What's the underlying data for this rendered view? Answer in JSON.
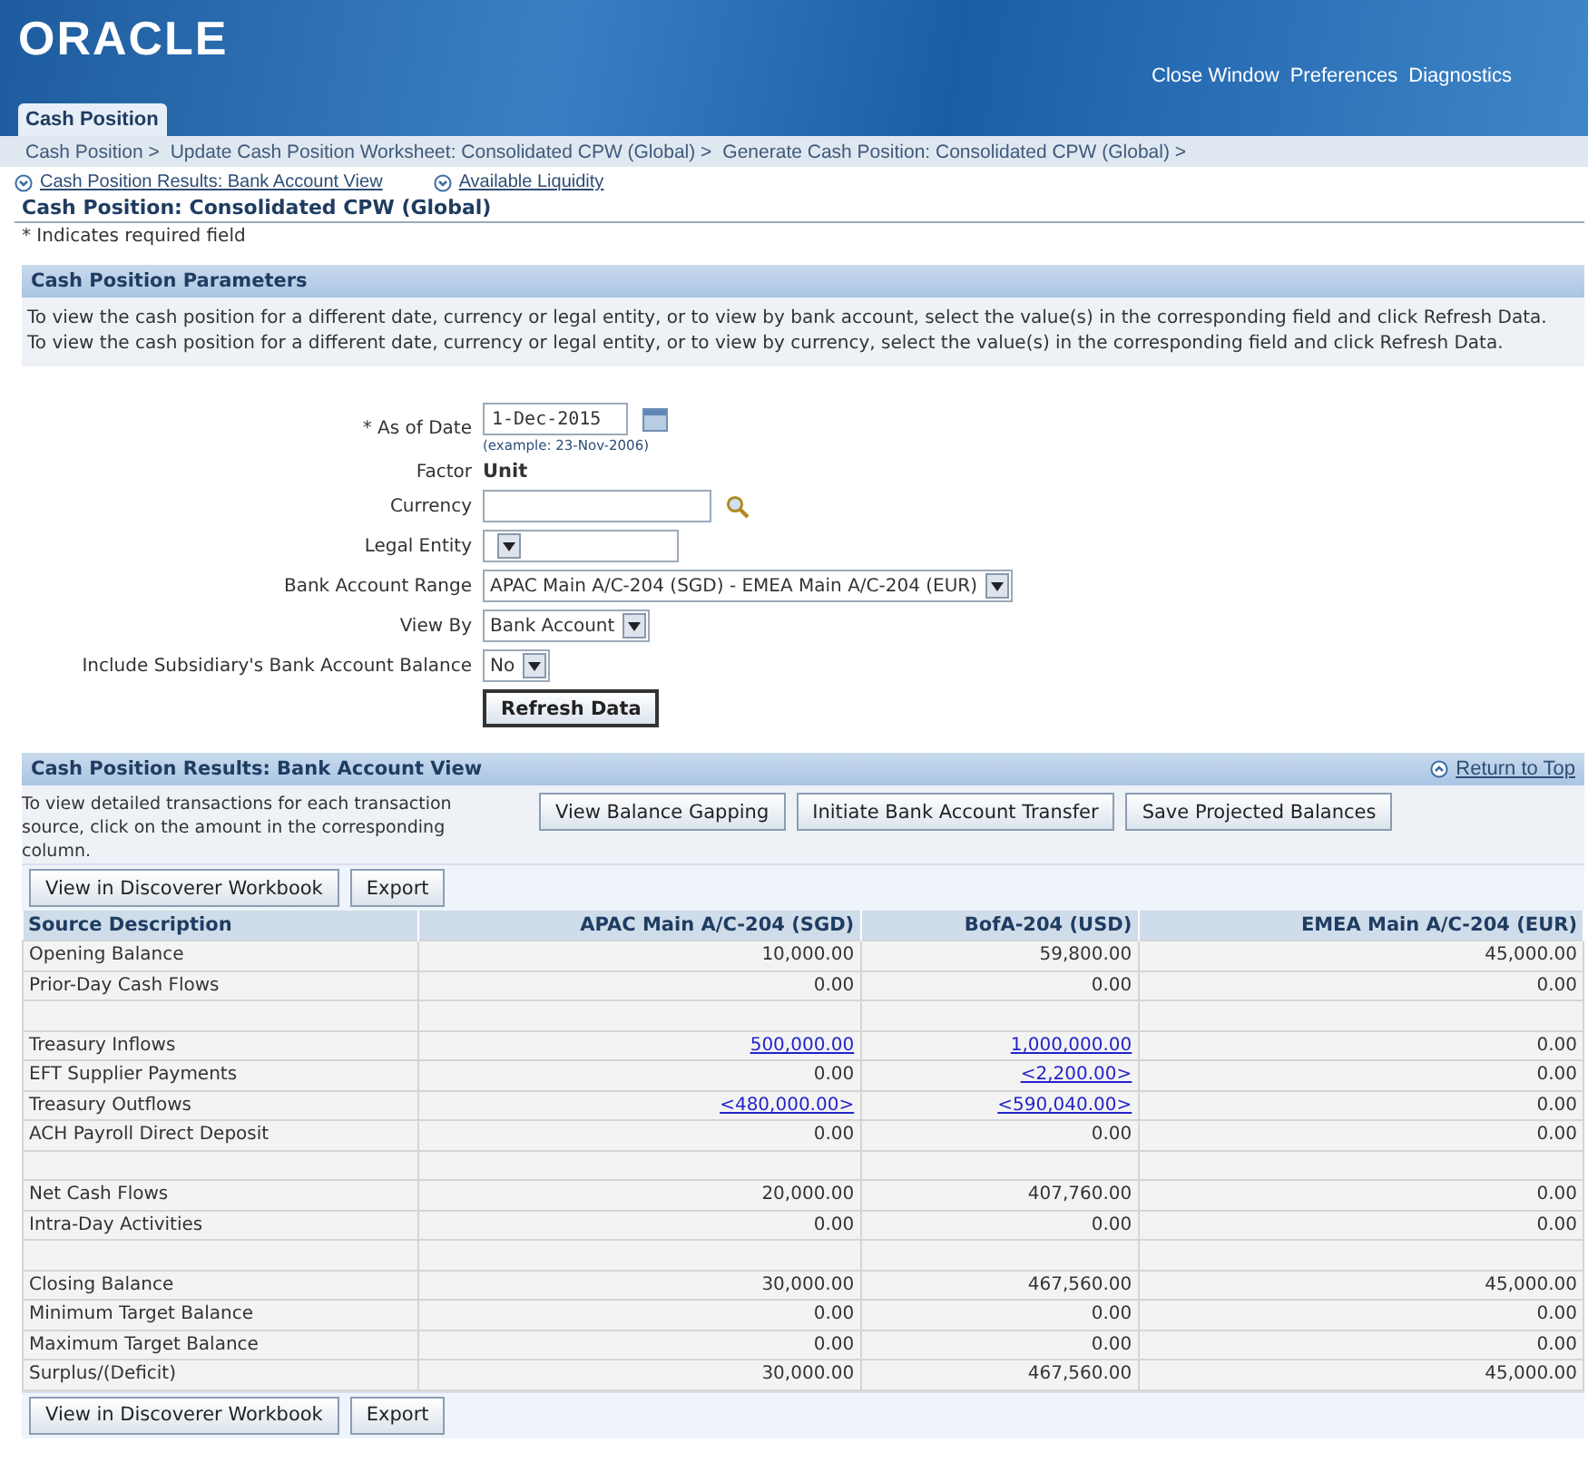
{
  "header": {
    "logo": "ORACLE",
    "links": [
      "Close Window",
      "Preferences",
      "Diagnostics"
    ],
    "tab": {
      "label": "Cash Position",
      "selected": true
    }
  },
  "breadcrumbs": [
    "Cash Position >",
    "Update Cash Position Worksheet: Consolidated CPW (Global) >",
    "Generate Cash Position: Consolidated CPW (Global) >"
  ],
  "quick_links": [
    "Cash Position Results: Bank Account View",
    "Available Liquidity"
  ],
  "page_title": "Cash Position: Consolidated CPW (Global)",
  "required_note": "* Indicates required field",
  "parameters": {
    "title": "Cash Position Parameters",
    "instructions": [
      "To view the cash position for a different date, currency or legal entity, or to view by bank account, select the value(s) in the corresponding field and click Refresh Data.",
      "To view the cash position for a different date, currency or legal entity, or to view by currency, select the value(s) in the corresponding field and click Refresh Data."
    ],
    "fields": [
      {
        "kind": "date",
        "label": "As of Date",
        "required_mark": "*",
        "value": "1-Dec-2015",
        "hint": "(example: 23-Nov-2006)"
      },
      {
        "kind": "static",
        "label": "Factor",
        "value": "Unit"
      },
      {
        "kind": "lookup",
        "label": "Currency"
      },
      {
        "kind": "select",
        "label": "Legal Entity"
      },
      {
        "kind": "select",
        "label": "Bank Account Range",
        "value": "APAC Main A/C-204 (SGD) - EMEA Main A/C-204 (EUR)"
      },
      {
        "kind": "select",
        "label": "View By",
        "value": "Bank Account"
      },
      {
        "kind": "select",
        "label": "Include Subsidiary's Bank Account Balance",
        "value": "No"
      }
    ],
    "button": "Refresh Data"
  },
  "results": {
    "title": "Cash Position Results: Bank Account View",
    "return_link": "Return to Top",
    "instructions": "To view detailed transactions for each transaction source, click on the amount in the corresponding column.",
    "actions": [
      "View Balance Gapping",
      "Initiate Bank Account Transfer",
      "Save Projected Balances"
    ],
    "table_buttons": [
      "View in Discoverer Workbook",
      "Export"
    ],
    "columns": [
      "Source Description",
      "APAC Main A/C-204 (SGD)",
      "BofA-204 (USD)",
      "EMEA Main A/C-204 (EUR)"
    ],
    "rows": [
      {
        "kind": "data",
        "label": "Opening Balance",
        "cells": [
          {
            "text": "10,000.00",
            "link": false
          },
          {
            "text": "59,800.00",
            "link": false
          },
          {
            "text": "45,000.00",
            "link": false
          }
        ]
      },
      {
        "kind": "data",
        "label": "Prior-Day Cash Flows",
        "cells": [
          {
            "text": "0.00",
            "link": false
          },
          {
            "text": "0.00",
            "link": false
          },
          {
            "text": "0.00",
            "link": false
          }
        ]
      },
      {
        "kind": "spacer"
      },
      {
        "kind": "data",
        "label": "Treasury Inflows",
        "cells": [
          {
            "text": "500,000.00",
            "link": true
          },
          {
            "text": "1,000,000.00",
            "link": true
          },
          {
            "text": "0.00",
            "link": false
          }
        ]
      },
      {
        "kind": "data",
        "label": "EFT Supplier Payments",
        "cells": [
          {
            "text": "0.00",
            "link": false
          },
          {
            "text": "<2,200.00>",
            "link": true
          },
          {
            "text": "0.00",
            "link": false
          }
        ]
      },
      {
        "kind": "data",
        "label": "Treasury Outflows",
        "cells": [
          {
            "text": "<480,000.00>",
            "link": true
          },
          {
            "text": "<590,040.00>",
            "link": true
          },
          {
            "text": "0.00",
            "link": false
          }
        ]
      },
      {
        "kind": "data",
        "label": "ACH Payroll Direct Deposit",
        "cells": [
          {
            "text": "0.00",
            "link": false
          },
          {
            "text": "0.00",
            "link": false
          },
          {
            "text": "0.00",
            "link": false
          }
        ]
      },
      {
        "kind": "spacer"
      },
      {
        "kind": "data",
        "label": "Net Cash Flows",
        "cells": [
          {
            "text": "20,000.00",
            "link": false
          },
          {
            "text": "407,760.00",
            "link": false
          },
          {
            "text": "0.00",
            "link": false
          }
        ]
      },
      {
        "kind": "data",
        "label": "Intra-Day Activities",
        "cells": [
          {
            "text": "0.00",
            "link": false
          },
          {
            "text": "0.00",
            "link": false
          },
          {
            "text": "0.00",
            "link": false
          }
        ]
      },
      {
        "kind": "spacer"
      },
      {
        "kind": "data",
        "label": "Closing Balance",
        "cells": [
          {
            "text": "30,000.00",
            "link": false
          },
          {
            "text": "467,560.00",
            "link": false
          },
          {
            "text": "45,000.00",
            "link": false
          }
        ]
      },
      {
        "kind": "data",
        "label": "Minimum Target Balance",
        "cells": [
          {
            "text": "0.00",
            "link": false
          },
          {
            "text": "0.00",
            "link": false
          },
          {
            "text": "0.00",
            "link": false
          }
        ]
      },
      {
        "kind": "data",
        "label": "Maximum Target Balance",
        "cells": [
          {
            "text": "0.00",
            "link": false
          },
          {
            "text": "0.00",
            "link": false
          },
          {
            "text": "0.00",
            "link": false
          }
        ]
      },
      {
        "kind": "data",
        "label": "Surplus/(Deficit)",
        "cells": [
          {
            "text": "30,000.00",
            "link": false
          },
          {
            "text": "467,560.00",
            "link": false
          },
          {
            "text": "45,000.00",
            "link": false
          }
        ]
      }
    ],
    "bottom_buttons": [
      "View in Discoverer Workbook",
      "Export"
    ]
  }
}
